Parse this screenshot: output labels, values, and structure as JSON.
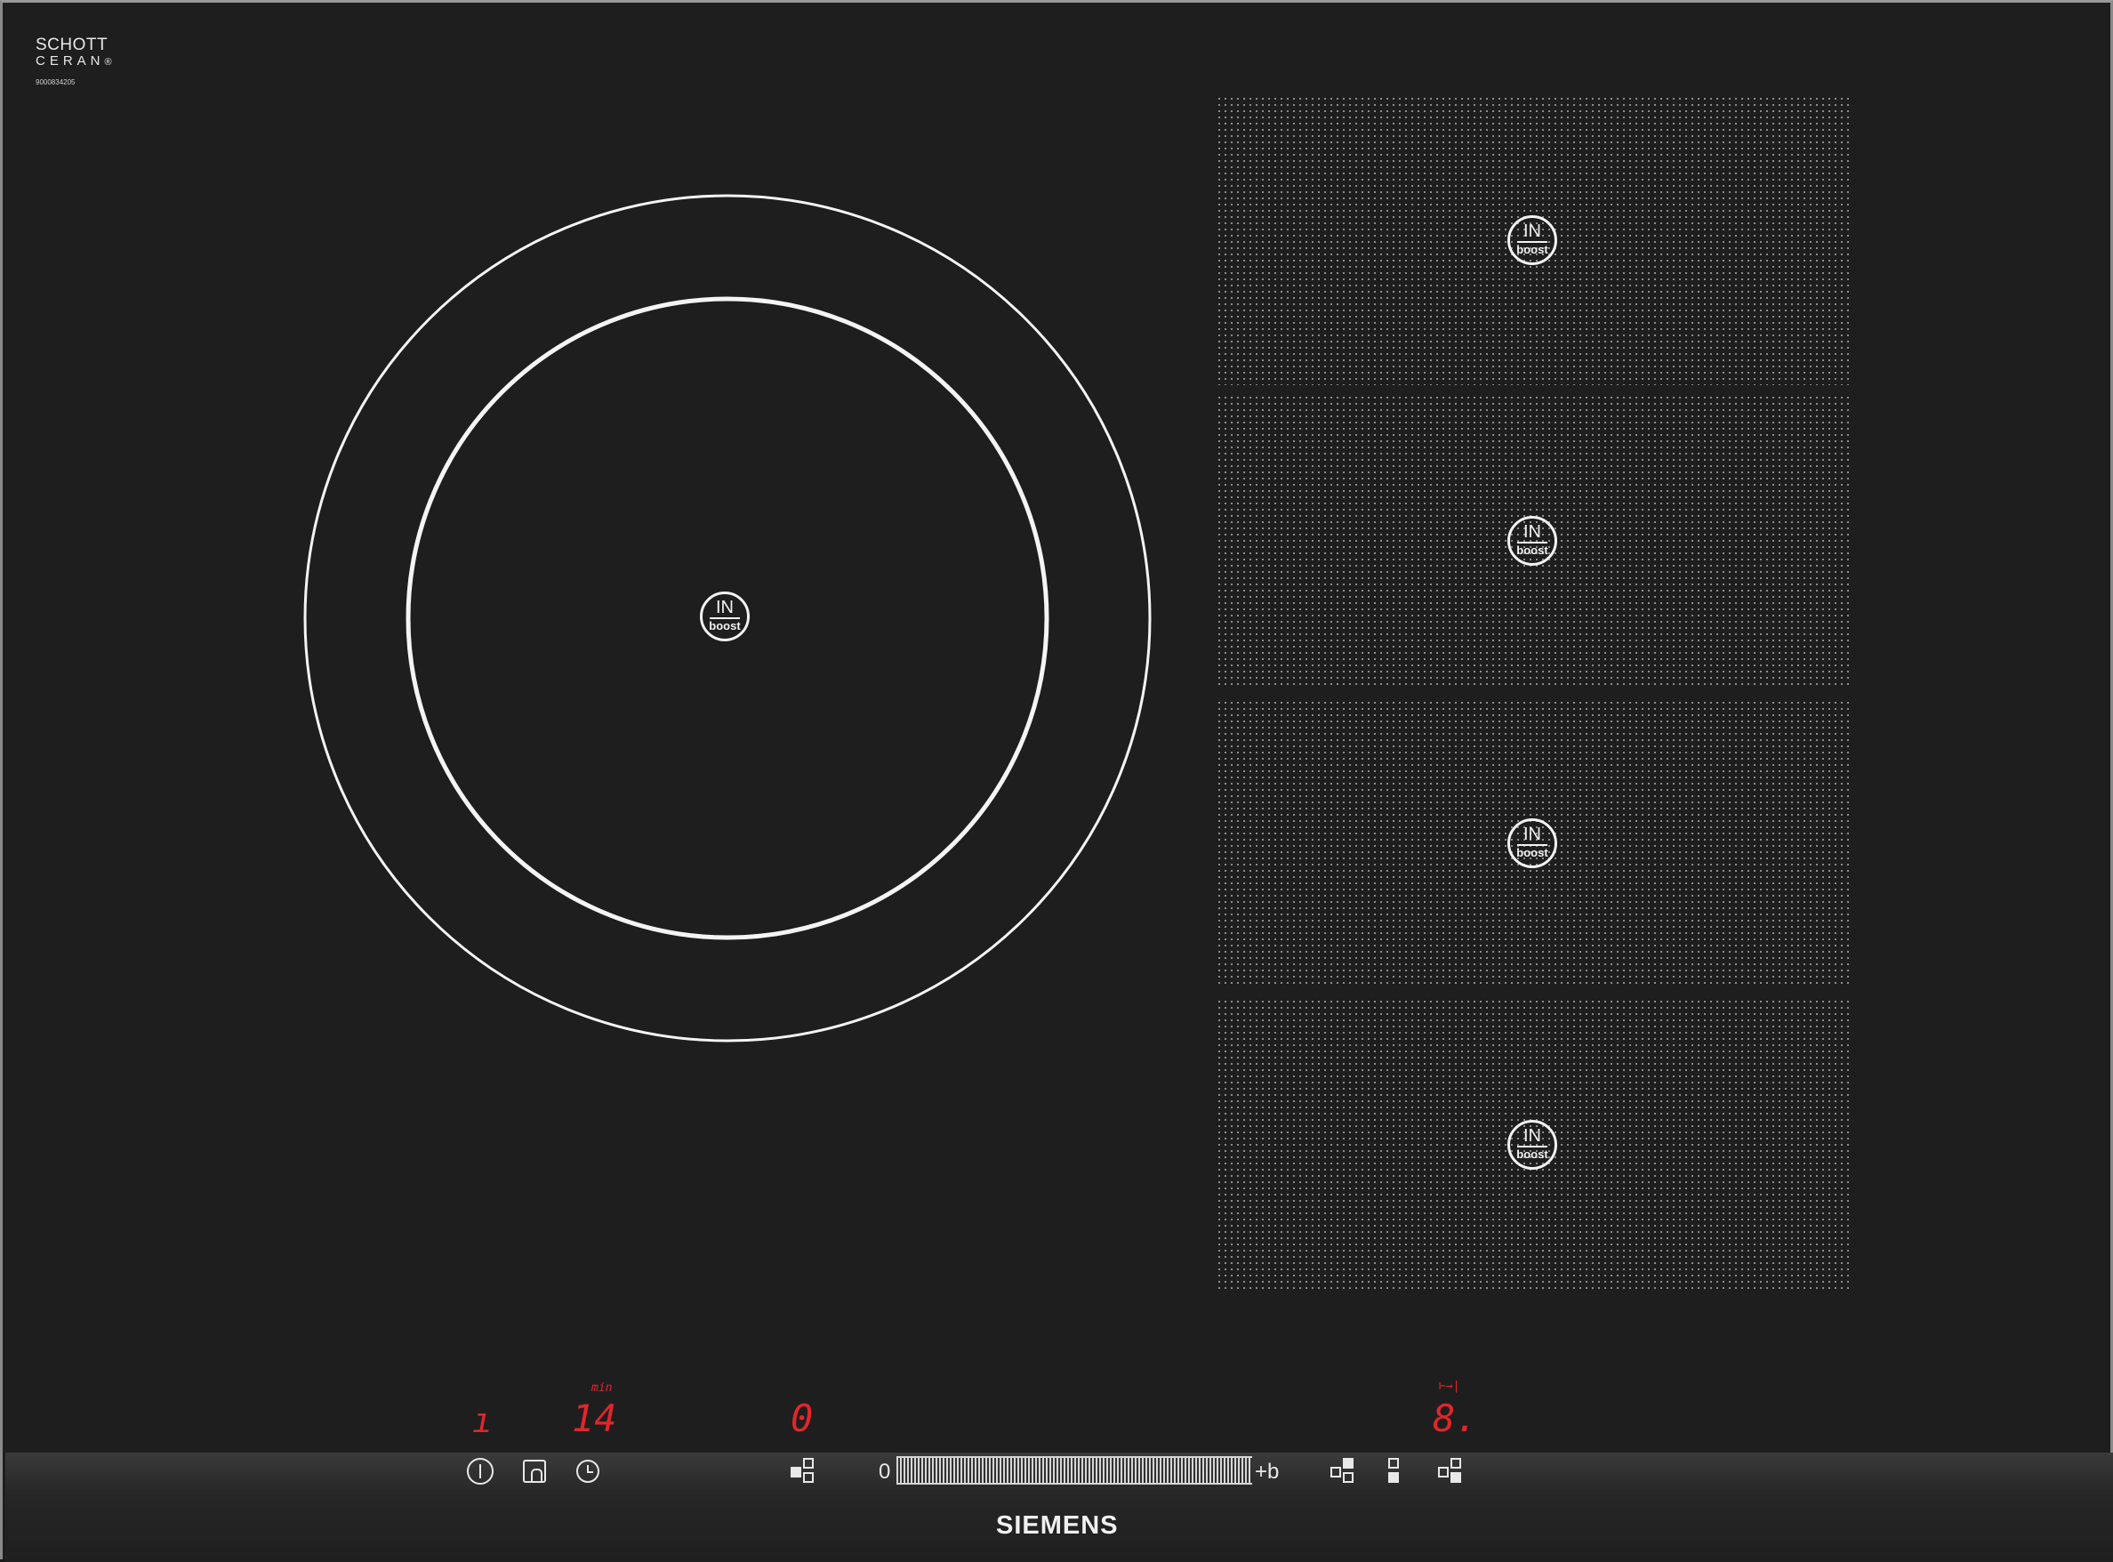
{
  "brand": {
    "logo_line1": "SCHOTT",
    "logo_line2": "CERAN",
    "logo_reg": "®",
    "serial": "9000834205",
    "name": "SIEMENS"
  },
  "zones": {
    "boost_in": "IN",
    "boost_label": "boost"
  },
  "displays": {
    "left_zone": "ı",
    "timer_unit": "min",
    "timer_value": "14",
    "center_zone": "0",
    "right_symbol": "⊢→|",
    "right_zone": "8."
  },
  "controls": {
    "slider_min": "0",
    "slider_max": "+b",
    "icons": [
      "power-icon",
      "child-lock-icon",
      "timer-clock-icon",
      "zone-select-icon",
      "flex-zone-icon",
      "zone-select-front-icon",
      "zone-select-back-icon"
    ]
  },
  "colors": {
    "glass": "#1e1e1e",
    "display_red": "#e0262b",
    "print_white": "#f2f2f2"
  }
}
